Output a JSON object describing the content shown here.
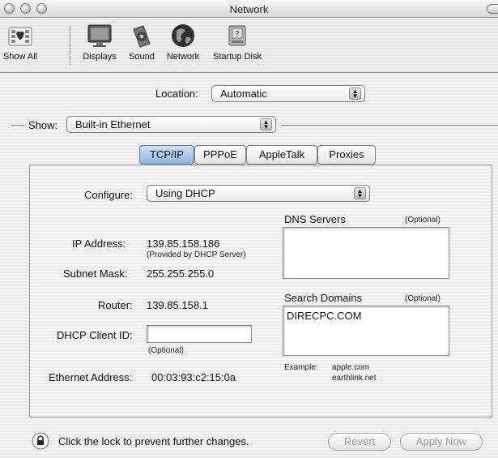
{
  "window": {
    "title": "Network"
  },
  "toolbar": {
    "items": [
      {
        "label": "Show All",
        "icon": "show-all-icon"
      },
      {
        "label": "Displays",
        "icon": "display-icon"
      },
      {
        "label": "Sound",
        "icon": "speaker-icon"
      },
      {
        "label": "Network",
        "icon": "globe-icon"
      },
      {
        "label": "Startup Disk",
        "icon": "disk-icon"
      }
    ]
  },
  "location": {
    "label": "Location:",
    "value": "Automatic"
  },
  "show": {
    "label": "Show:",
    "value": "Built-in Ethernet"
  },
  "tabs": [
    {
      "label": "TCP/IP",
      "selected": true
    },
    {
      "label": "PPPoE",
      "selected": false
    },
    {
      "label": "AppleTalk",
      "selected": false
    },
    {
      "label": "Proxies",
      "selected": false
    }
  ],
  "tcpip": {
    "configure_label": "Configure:",
    "configure_value": "Using DHCP",
    "ip_label": "IP Address:",
    "ip_value": "139.85.158.186",
    "ip_note": "(Provided by DHCP Server)",
    "subnet_label": "Subnet Mask:",
    "subnet_value": "255.255.255.0",
    "router_label": "Router:",
    "router_value": "139.85.158.1",
    "dhcp_label": "DHCP Client ID:",
    "dhcp_value": "",
    "dhcp_note": "(Optional)",
    "ethernet_label": "Ethernet Address:",
    "ethernet_value": "00:03:93:c2:15:0a",
    "dns_label": "DNS Servers",
    "dns_optional": "(Optional)",
    "dns_value": "",
    "search_label": "Search Domains",
    "search_optional": "(Optional)",
    "search_value": "DIRECPC.COM",
    "example_label": "Example:",
    "example_line1": "apple.com",
    "example_line2": "earthlink.net"
  },
  "footer": {
    "lock_text": "Click the lock to prevent further changes.",
    "revert_label": "Revert",
    "apply_label": "Apply Now"
  }
}
